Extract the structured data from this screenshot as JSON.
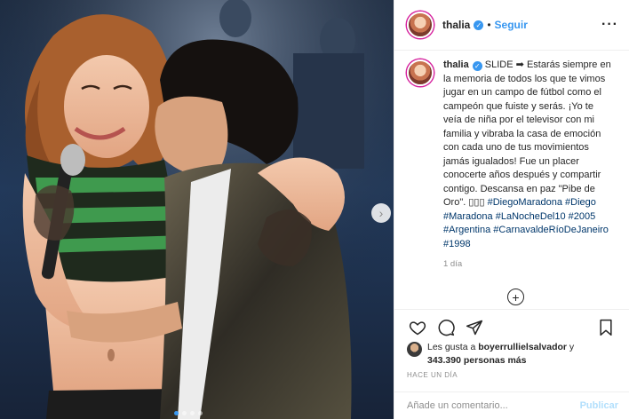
{
  "post": {
    "username": "thalia",
    "follow_label": "Seguir",
    "separator": "•",
    "more_icon": "more-horizontal-icon",
    "verified_icon": "verified-badge-icon"
  },
  "caption": {
    "username": "thalia",
    "header_text": "SLIDE ➡",
    "body": "Estarás siempre en la memoria de todos los que te vimos jugar en un campo de fútbol como el campeón que fuiste y serás. ¡Yo te veía de niña por el televisor con mi familia y vibraba la casa de emoción con cada uno de tus movimientos jamás igualados! Fue un placer conocerte años después y compartir contigo. Descansa en paz \"Pibe de Oro\". ▯▯▯",
    "hashtags": [
      "#DiegoMaradona",
      "#Diego",
      "#Maradona",
      "#LaNocheDel10",
      "#2005",
      "#Argentina",
      "#CarnavaldeRíoDeJaneiro",
      "#1998"
    ],
    "time": "1 día"
  },
  "likes": {
    "prefix": "Les gusta a",
    "user": "boyerrullielsalvador",
    "middle": " y",
    "count": "343.390 personas más"
  },
  "posted_ago": "HACE UN DÍA",
  "comment": {
    "placeholder": "Añade un comentario...",
    "publish_label": "Publicar"
  },
  "carousel": {
    "slides": 4,
    "active": 0
  },
  "colors": {
    "link": "#3897f0",
    "hashtag": "#00376b",
    "muted": "#8e8e8e",
    "border": "#efefef"
  }
}
